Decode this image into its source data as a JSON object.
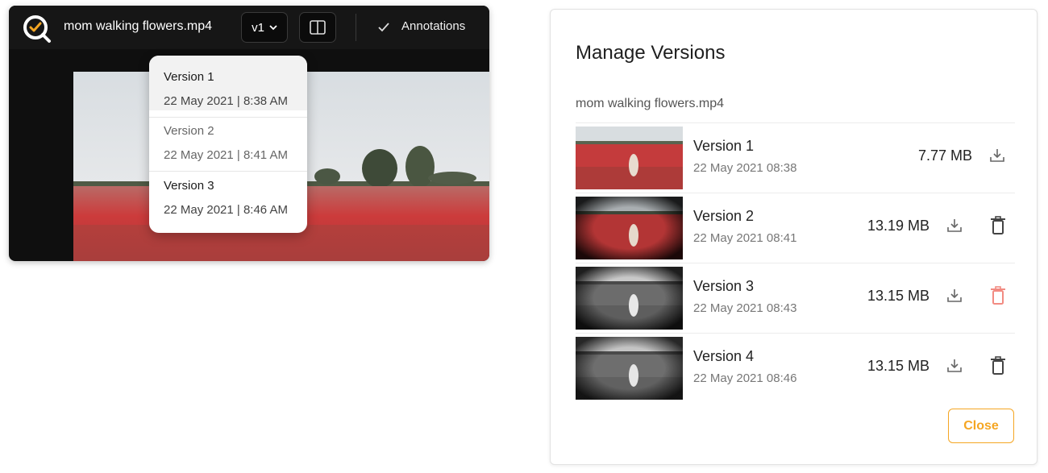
{
  "player": {
    "file_title": "mom walking flowers.mp4",
    "version_selector": "v1",
    "annotations_label": "Annotations",
    "dropdown": [
      {
        "name": "Version 1",
        "date": "22 May 2021 | 8:38 AM"
      },
      {
        "name": "Version 2",
        "date": "22 May 2021 | 8:41 AM"
      },
      {
        "name": "Version 3",
        "date": "22 May 2021 | 8:46 AM"
      }
    ]
  },
  "dialog": {
    "title": "Manage Versions",
    "subtitle": "mom walking flowers.mp4",
    "versions": [
      {
        "name": "Version 1",
        "date": "22 May 2021 08:38",
        "size": "7.77 MB"
      },
      {
        "name": "Version 2",
        "date": "22 May 2021 08:41",
        "size": "13.19 MB"
      },
      {
        "name": "Version 3",
        "date": "22 May 2021 08:43",
        "size": "13.15 MB"
      },
      {
        "name": "Version 4",
        "date": "22 May 2021 08:46",
        "size": "13.15 MB"
      }
    ],
    "close_label": "Close"
  },
  "colors": {
    "accent": "#f5a623",
    "delete_hover": "#f28b82",
    "player_bg": "#0f0f0f"
  },
  "icons": [
    "logo-icon",
    "chevron-down-icon",
    "split-view-icon",
    "checkbox-icon",
    "download-icon",
    "trash-icon"
  ]
}
